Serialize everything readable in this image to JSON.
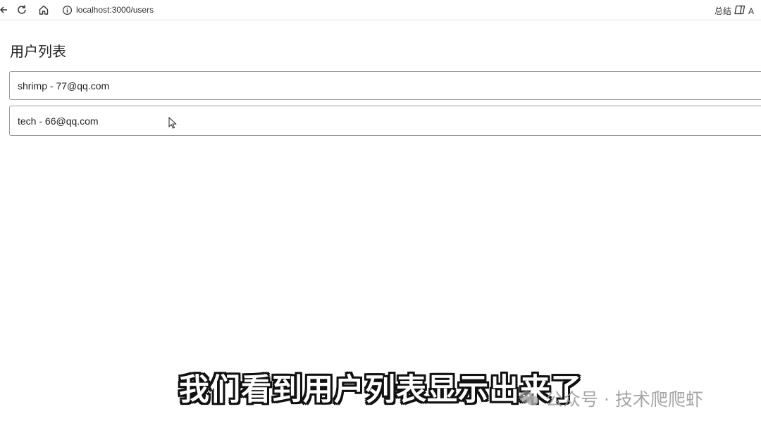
{
  "browser": {
    "url": "localhost:3000/users",
    "summary_label": "总结",
    "extra_label": "A"
  },
  "page": {
    "title": "用户列表",
    "users": [
      {
        "label": "shrimp - 77@qq.com"
      },
      {
        "label": "tech - 66@qq.com"
      }
    ]
  },
  "overlay": {
    "subtitle": "我们看到用户列表显示出来了",
    "watermark": "公众号 · 技术爬爬虾"
  },
  "icons": {
    "back": "arrow-left-icon",
    "reload": "reload-icon",
    "home": "home-icon",
    "site_info": "info-icon",
    "summary": "copilot-icon",
    "cursor": "mouse-cursor-icon",
    "watermark": "wechat-icon"
  }
}
